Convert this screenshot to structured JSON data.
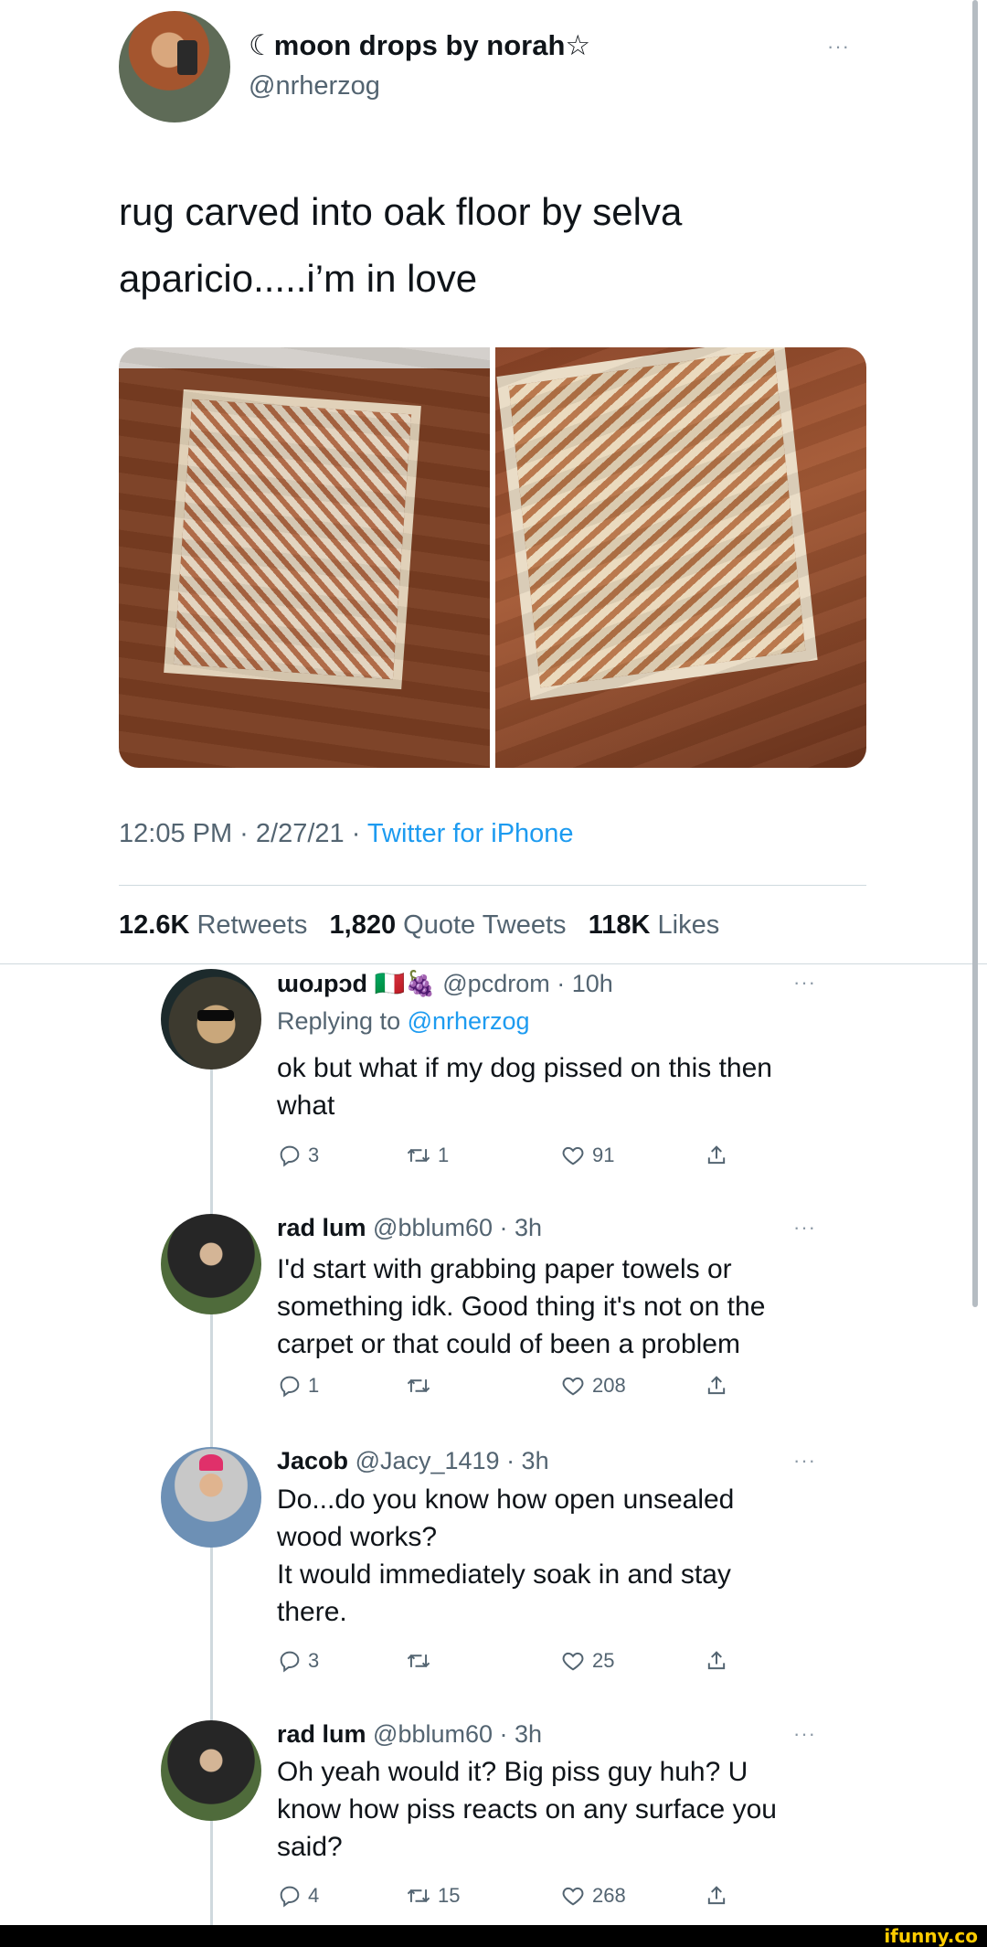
{
  "original": {
    "display_name": "☾moon drops by norah☆",
    "handle": "@nrherzog",
    "text_line1": "rug carved into oak floor by selva",
    "text_line2": "aparicio.....i’m in love",
    "time": "12:05 PM · 2/27/21 · ",
    "source": "Twitter for iPhone",
    "retweets_count": "12.6K",
    "retweets_label": "Retweets",
    "quotes_count": "1,820",
    "quotes_label": "Quote Tweets",
    "likes_count": "118K",
    "likes_label": "Likes",
    "more": "···"
  },
  "replies": [
    {
      "display_name": "ɯoɹpɔd 🇮🇹🍇",
      "handle_time": "@pcdrom · 10h",
      "replying_prefix": "Replying to ",
      "replying_to": "@nrherzog",
      "lines": [
        "ok but what if my dog pissed on this then",
        "what"
      ],
      "reply_count": "3",
      "retweet_count": "1",
      "like_count": "91",
      "more": "···"
    },
    {
      "display_name": "rad lum",
      "handle_time": "@bblum60 · 3h",
      "lines": [
        "I'd start with grabbing paper towels or",
        "something idk. Good thing it's not on the",
        "carpet or that could of been a problem"
      ],
      "reply_count": "1",
      "retweet_count": "",
      "like_count": "208",
      "more": "···"
    },
    {
      "display_name": "Jacob",
      "handle_time": "@Jacy_1419 · 3h",
      "lines": [
        "Do...do you know how open unsealed",
        "wood works?",
        "It would immediately soak in and stay",
        "there."
      ],
      "reply_count": "3",
      "retweet_count": "",
      "like_count": "25",
      "more": "···"
    },
    {
      "display_name": "rad lum",
      "handle_time": "@bblum60 · 3h",
      "lines": [
        "Oh yeah would it? Big piss guy huh? U",
        "know how piss reacts on any surface you",
        "said?"
      ],
      "reply_count": "4",
      "retweet_count": "15",
      "like_count": "268",
      "more": "···"
    }
  ],
  "watermark": "ifunny.co",
  "icons": {
    "reply": "reply-icon",
    "retweet": "retweet-icon",
    "like": "heart-icon",
    "share": "share-icon"
  },
  "colors": {
    "link": "#1d9bf0",
    "muted": "#536471",
    "text": "#0f1419",
    "divider": "#cfd9de"
  }
}
